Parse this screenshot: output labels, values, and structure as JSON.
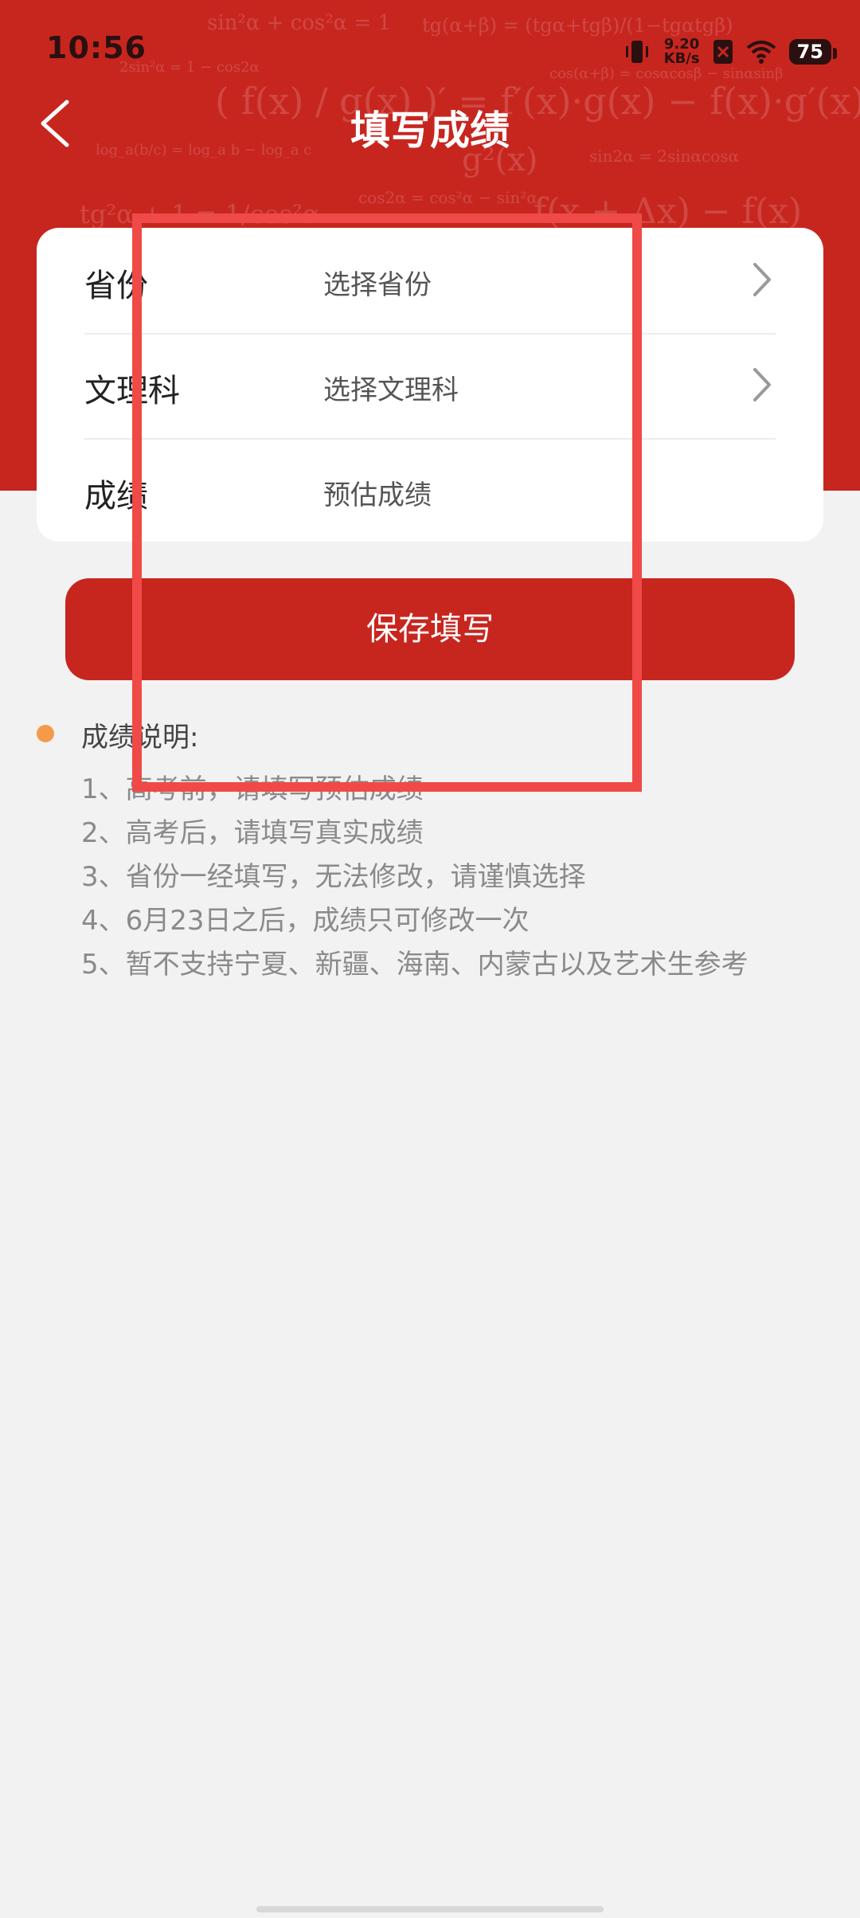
{
  "status_bar": {
    "time": "10:56",
    "net_speed_value": "9.20",
    "net_speed_unit": "KB/s",
    "battery": "75"
  },
  "header": {
    "title": "填写成绩",
    "background_color": "#c7261f"
  },
  "form": {
    "rows": [
      {
        "label": "省份",
        "value": "选择省份",
        "has_chevron": true
      },
      {
        "label": "文理科",
        "value": "选择文理科",
        "has_chevron": true
      },
      {
        "label": "成绩",
        "placeholder": "预估成绩",
        "has_chevron": false
      }
    ]
  },
  "save_button": {
    "label": "保存填写",
    "color": "#c7261f"
  },
  "notes": {
    "title": "成绩说明:",
    "items": [
      "1、高考前，请填写预估成绩",
      "2、高考后，请填写真实成绩",
      "3、省份一经填写，无法修改，请谨慎选择",
      "4、6月23日之后，成绩只可修改一次",
      "5、暂不支持宁夏、新疆、海南、内蒙古以及艺术生参考"
    ],
    "bullet_color": "#f59a4a"
  },
  "overlay": {
    "highlight_color": "#ef4a47"
  }
}
